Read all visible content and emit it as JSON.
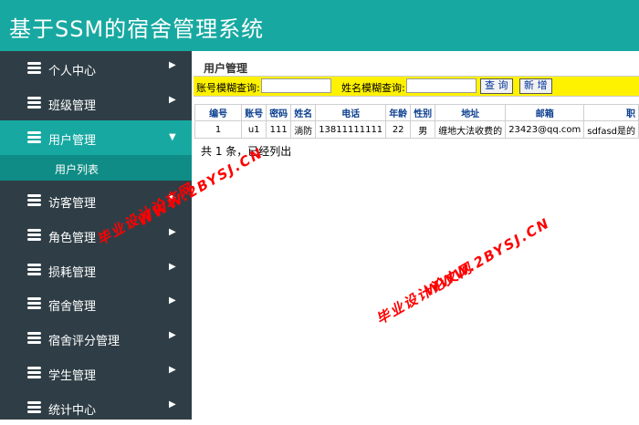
{
  "app": {
    "title": "基于SSM的宿舍管理系统"
  },
  "sidebar": {
    "items": [
      {
        "label": "个人中心",
        "chevron": "▶"
      },
      {
        "label": "班级管理",
        "chevron": "▶"
      },
      {
        "label": "用户管理",
        "chevron": "▼"
      },
      {
        "label": "访客管理",
        "chevron": "▶"
      },
      {
        "label": "角色管理",
        "chevron": "▶"
      },
      {
        "label": "损耗管理",
        "chevron": "▶"
      },
      {
        "label": "宿舍管理",
        "chevron": "▶"
      },
      {
        "label": "宿舍评分管理",
        "chevron": "▶"
      },
      {
        "label": "学生管理",
        "chevron": "▶"
      },
      {
        "label": "统计中心",
        "chevron": "▶"
      }
    ],
    "subitem": "用户列表"
  },
  "main": {
    "breadcrumb": "用户管理",
    "search": {
      "account_label": "账号模糊查询:",
      "account_value": "",
      "name_label": "姓名模糊查询:",
      "name_value": "",
      "query_button": "查 询",
      "add_button": "新 增"
    },
    "table": {
      "headers": [
        "编号",
        "账号",
        "密码",
        "姓名",
        "电话",
        "年龄",
        "性别",
        "地址",
        "邮箱",
        "职"
      ],
      "rows": [
        [
          "1",
          "u1",
          "111",
          "淌防",
          "13811111111",
          "22",
          "男",
          "缠地大法收费的",
          "23423@qq.com",
          "sdfasd是的"
        ]
      ]
    },
    "summary": "共 1 条，已经列出"
  },
  "watermarks": {
    "text1": "毕业设计论文网",
    "text2": "WWW.2BYSJ.CN"
  },
  "colors": {
    "header": "#17a9a1",
    "sidebar": "#2f3e46",
    "search_bar": "#fff200",
    "watermark": "#ff0000"
  }
}
